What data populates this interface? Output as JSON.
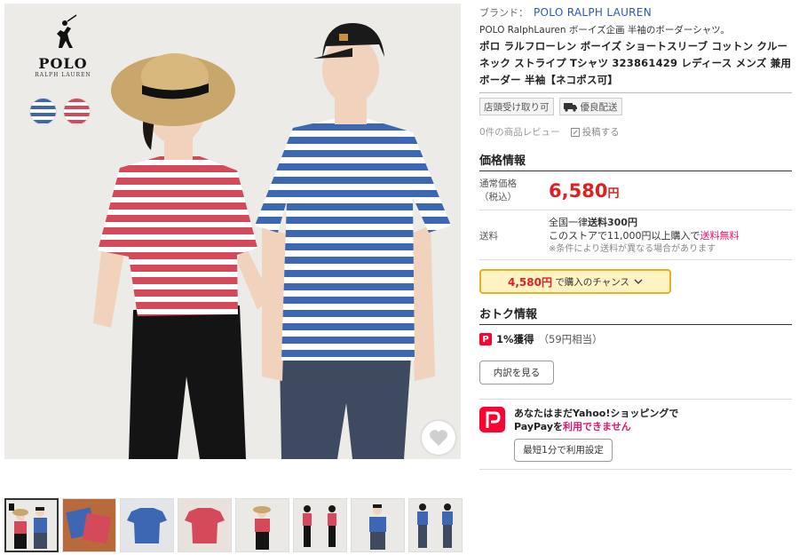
{
  "product_image": {
    "logo_text": "POLO",
    "logo_sub": "RALPH LAUREN",
    "swatches": [
      "blue-stripe",
      "red-stripe"
    ],
    "favorite_icon": "heart-icon",
    "colors": {
      "red_stripe": "#d54a5b",
      "blue_stripe": "#3d67b3",
      "background": "#ecebe8"
    }
  },
  "thumbnails": [
    {
      "name": "thumb-couple",
      "active": true
    },
    {
      "name": "thumb-folded-shirts",
      "active": false
    },
    {
      "name": "thumb-blue-shirt",
      "active": false
    },
    {
      "name": "thumb-red-shirt",
      "active": false
    },
    {
      "name": "thumb-woman-front",
      "active": false
    },
    {
      "name": "thumb-woman-sides",
      "active": false
    },
    {
      "name": "thumb-man-front",
      "active": false
    },
    {
      "name": "thumb-man-sides",
      "active": false
    }
  ],
  "info": {
    "brand_label": "ブランド：",
    "brand_name": "POLO RALPH LAUREN",
    "subtitle": "POLO RalphLauren ボーイズ企画 半袖のボーダーシャツ。",
    "title": "ポロ ラルフローレン ボーイズ ショートスリーブ コットン クルーネック ストライプ Tシャツ 323861429 レディース メンズ 兼用 ボーダー 半袖【ネコポス可】",
    "badge_pickup": "店頭受け取り可",
    "badge_shipping": "優良配送",
    "reviews": "0件の商品レビュー",
    "write_review": "投稿する",
    "price_section_title": "価格情報",
    "price_label_line1": "通常価格",
    "price_label_line2": "（税込）",
    "price_value": "6,580",
    "price_yen": "円",
    "shipping_label": "送料",
    "shipping_line1_prefix": "全国一律",
    "shipping_line1_bold": "送料300円",
    "shipping_line2_prefix": "このストアで11,000円以上購入で",
    "shipping_line2_red": "送料無料",
    "shipping_note": "※条件により送料が異なる場合があります",
    "chance_price": "4,580円",
    "chance_text": "で購入のチャンス",
    "otoku_title": "おトク情報",
    "points_pct": "1%獲得",
    "points_sub": "（59円相当）",
    "breakdown_button": "内訳を見る",
    "paypay_line1": "あなたはまだYahoo!ショッピングで",
    "paypay_line2_prefix": "PayPayを",
    "paypay_line2_red": "利用できません",
    "setup_button": "最短1分で利用設定",
    "accent_red": "#e02020",
    "accent_pink": "#e0176f",
    "link_blue": "#2b58b8"
  }
}
